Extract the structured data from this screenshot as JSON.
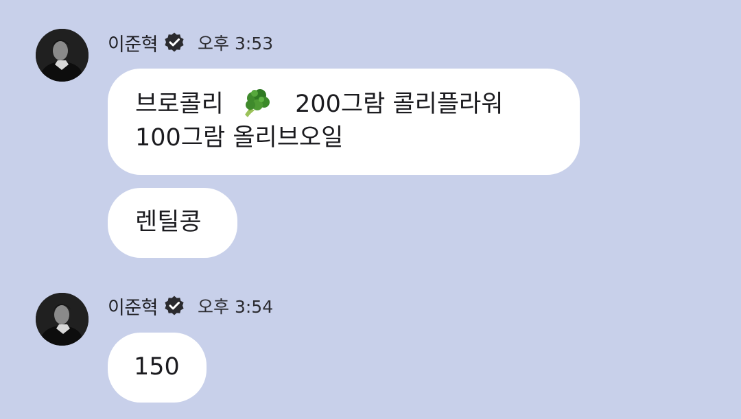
{
  "messages": [
    {
      "sender": "이준혁",
      "time": "오후 3:53",
      "bubbles": [
        {
          "line1_before": "브로콜리",
          "emoji": "broccoli-emoji",
          "line1_after": "200그람 콜리플라워",
          "line2": "100그람 올리브오일"
        },
        {
          "text": "렌틸콩"
        }
      ]
    },
    {
      "sender": "이준혁",
      "time": "오후 3:54",
      "bubbles": [
        {
          "text": "150"
        }
      ]
    }
  ],
  "colors": {
    "background": "#c8d0ea",
    "bubble": "#ffffff",
    "verified_badge": "#2a2a2e"
  },
  "icons": {
    "verified": "verified-badge-icon",
    "avatar": "profile-photo"
  }
}
